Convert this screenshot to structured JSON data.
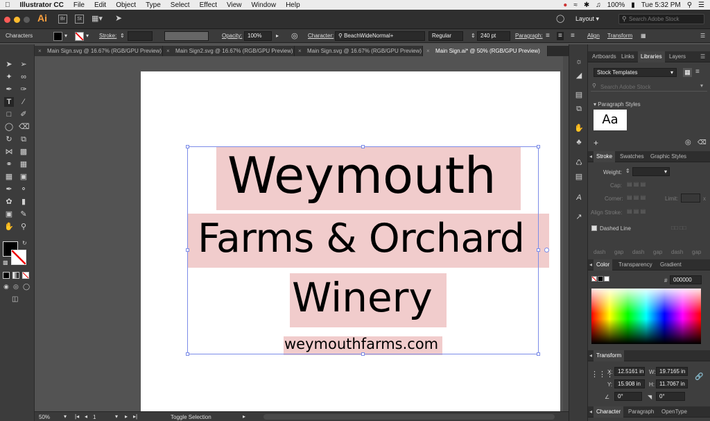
{
  "menubar": {
    "app_name": "Illustrator CC",
    "items": [
      "File",
      "Edit",
      "Object",
      "Type",
      "Select",
      "Effect",
      "View",
      "Window",
      "Help"
    ],
    "battery": "100%",
    "clock": "Tue 5:32 PM"
  },
  "appbar": {
    "layout_label": "Layout",
    "search_placeholder": "Search Adobe Stock"
  },
  "control": {
    "selection_label": "Characters",
    "stroke_label": "Stroke:",
    "opacity_label": "Opacity:",
    "opacity_value": "100%",
    "character_label": "Character:",
    "font_name": "BeachWideNormal+",
    "font_style": "Regular",
    "font_size": "240 pt",
    "paragraph_label": "Paragraph:",
    "align_label": "Align",
    "transform_label": "Transform"
  },
  "tabs": [
    {
      "label": "Main Sign.svg @ 16.67% (RGB/GPU Preview)"
    },
    {
      "label": "Main Sign2.svg @ 16.67% (RGB/GPU Preview)"
    },
    {
      "label": "Main Sign.svg @ 16.67% (RGB/GPU Preview)"
    },
    {
      "label": "Main Sign.ai* @ 50% (RGB/GPU Preview)"
    }
  ],
  "artwork": {
    "line1": "Weymouth",
    "line2": "Farms & Orchard",
    "line3": "Winery",
    "line4": "weymouthfarms.com",
    "highlight_color": "#f1cccc"
  },
  "panels": {
    "top_tabs": [
      "Artboards",
      "Links",
      "Libraries",
      "Layers"
    ],
    "library_select": "Stock Templates",
    "library_search_placeholder": "Search Adobe Stock",
    "paragraph_styles_label": "Paragraph Styles",
    "style_sample": "Aa",
    "stroke_tabs": [
      "Stroke",
      "Swatches",
      "Graphic Styles"
    ],
    "weight_label": "Weight:",
    "cap_label": "Cap:",
    "corner_label": "Corner:",
    "limit_label": "Limit:",
    "limit_unit": "x",
    "align_stroke_label": "Align Stroke:",
    "dashed_line_label": "Dashed Line",
    "dash_labels": [
      "dash",
      "gap",
      "dash",
      "gap",
      "dash",
      "gap"
    ],
    "color_tabs": [
      "Color",
      "Transparency",
      "Gradient"
    ],
    "hex_symbol": "#",
    "hex_value": "000000",
    "transform_label": "Transform",
    "x_label": "X:",
    "x_value": "12.5161 in",
    "y_label": "Y:",
    "y_value": "15.908 in",
    "w_label": "W:",
    "w_value": "19.7165 in",
    "h_label": "H:",
    "h_value": "11.7067 in",
    "rotate_value": "0°",
    "shear_value": "0°",
    "bottom_tabs": [
      "Character",
      "Paragraph",
      "OpenType"
    ]
  },
  "status": {
    "zoom": "50%",
    "artboard_number": "1",
    "status_text": "Toggle Selection"
  }
}
